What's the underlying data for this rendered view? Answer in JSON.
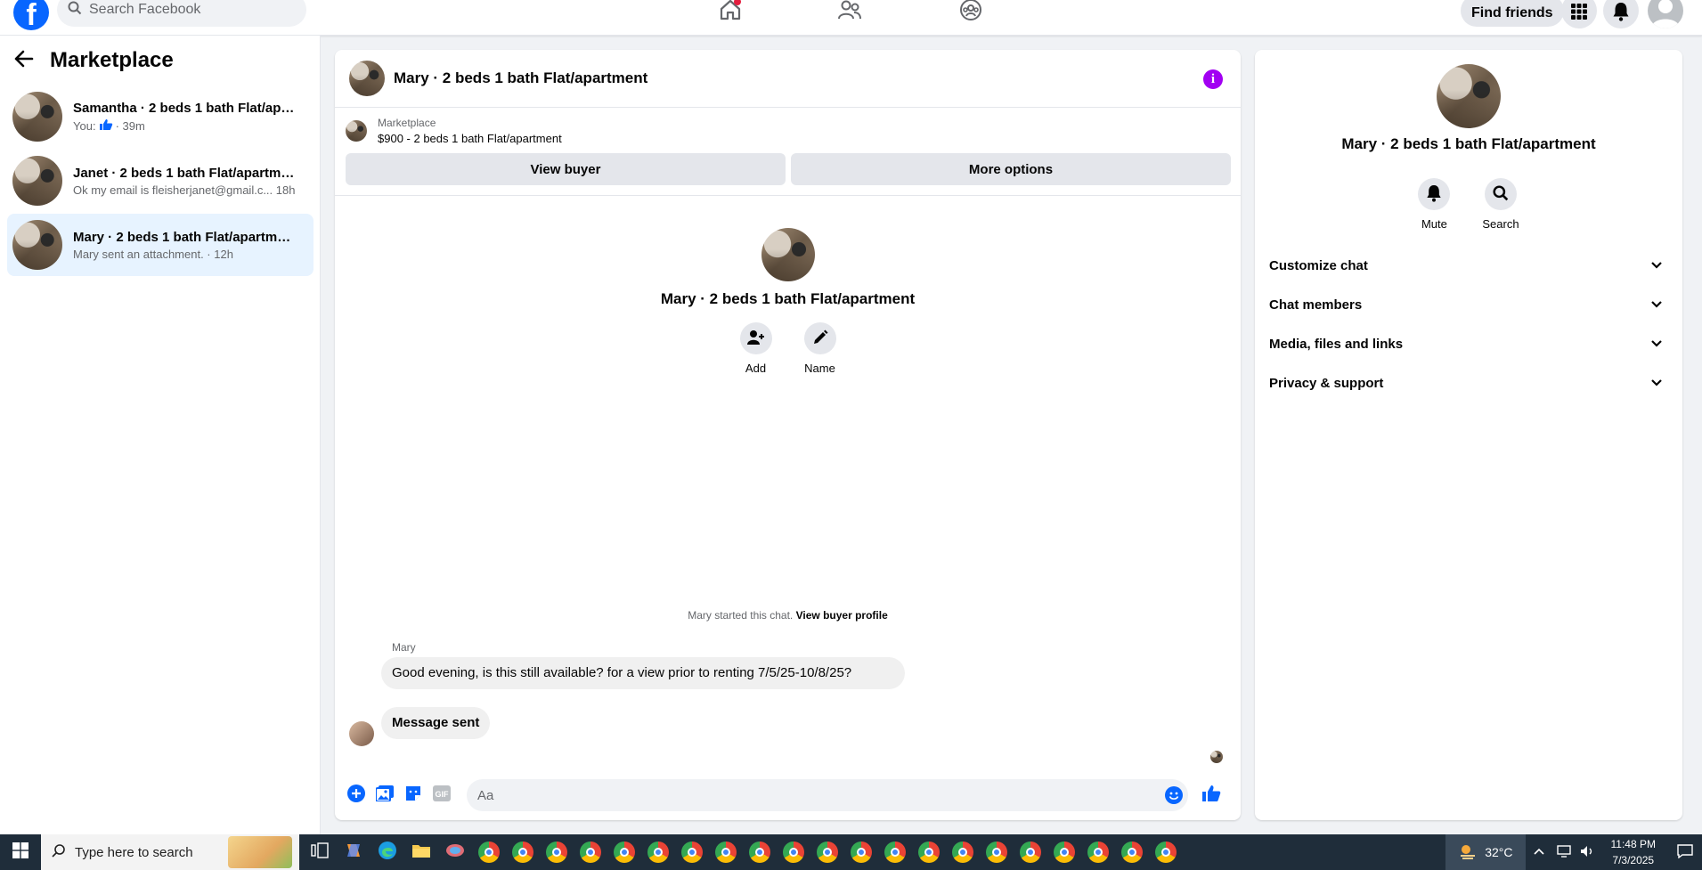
{
  "topbar": {
    "logo": "f",
    "search_placeholder": "Search Facebook",
    "find_friends": "Find friends"
  },
  "sidebar": {
    "title": "Marketplace",
    "conversations": [
      {
        "name": "Samantha · 2 beds 1 bath Flat/apar...",
        "preview_prefix": "You:",
        "preview_suffix": "· 39m",
        "active": false
      },
      {
        "name": "Janet · 2 beds 1 bath Flat/apartment",
        "preview": "Ok my email is fleisherjanet@gmail.c...  18h",
        "active": false
      },
      {
        "name": "Mary · 2 beds 1 bath Flat/apartment",
        "preview": "Mary sent an attachment. · 12h",
        "active": true
      }
    ]
  },
  "chat": {
    "title": "Mary · 2 beds 1 bath Flat/apartment",
    "marketplace_label": "Marketplace",
    "listing": "$900 - 2 beds 1 bath Flat/apartment",
    "view_buyer": "View buyer",
    "more_options": "More options",
    "intro_name": "Mary · 2 beds 1 bath Flat/apartment",
    "add_label": "Add",
    "name_label": "Name",
    "started_text": "Mary started this chat.",
    "view_buyer_profile": "View buyer profile",
    "sender": "Mary",
    "message_1": "Good evening, is this still available?    for   a   view   prior   to   renting  7/5/25-10/8/25?",
    "message_2": "Message sent",
    "composer_placeholder": "Aa"
  },
  "right_panel": {
    "name": "Mary · 2 beds 1 bath Flat/apartment",
    "mute": "Mute",
    "search": "Search",
    "sections": [
      "Customize chat",
      "Chat members",
      "Media, files and links",
      "Privacy & support"
    ]
  },
  "taskbar": {
    "search_placeholder": "Type here to search",
    "temperature": "32°C",
    "time": "11:48 PM",
    "date": "7/3/2025"
  },
  "colors": {
    "brand": "#0866ff",
    "info": "#a200f2",
    "active_conversation": "#e7f3ff"
  }
}
